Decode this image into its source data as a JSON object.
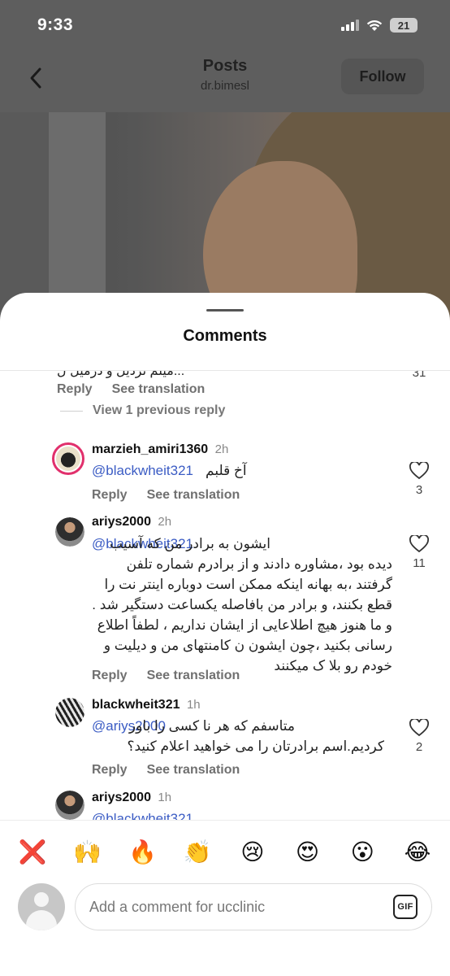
{
  "status": {
    "time": "9:33",
    "battery": "21"
  },
  "header": {
    "title": "Posts",
    "subtitle": "dr.bimesl",
    "follow_label": "Follow"
  },
  "sheet": {
    "title": "Comments"
  },
  "cut_comment": {
    "text": "...ميلم ترديل و درميل ل",
    "actions": {
      "reply": "Reply",
      "translate": "See translation"
    },
    "likes": "31"
  },
  "view_replies": "View 1 previous reply",
  "comments": [
    {
      "user": "marzieh_amiri1360",
      "time": "2h",
      "mention": "@blackwheit321",
      "text": "آخ قلبم",
      "reply": "Reply",
      "translate": "See translation",
      "likes": "3"
    },
    {
      "user": "ariys2000",
      "time": "2h",
      "mention": "@blackwheit321",
      "text": "ایشون به برادر من که آسیب دیده بود ،مشاوره دادند و از برادرم شماره تلفن گرفتند ،به بهانه اینکه ممکن است دوباره اینتر نت را قطع بکنند، و برادر من بافاصله یکساعت دستگیر شد . و ما هنوز هیچ اطلاعایی از ایشان نداریم ، لطفاً اطلاع رسانی بکنید ،چون ایشون ن کامنتهای من و دیلیت و خودم رو بلا ک میکنند",
      "reply": "Reply",
      "translate": "See translation",
      "likes": "11"
    },
    {
      "user": "blackwheit321",
      "time": "1h",
      "mention": "@ariys2000",
      "text": "متاسفم که هر نا کسی را باور کردیم.اسم برادرتان را می خواهید اعلام کنید؟",
      "reply": "Reply",
      "translate": "See translation",
      "likes": "2"
    },
    {
      "user": "ariys2000",
      "time": "1h",
      "mention": "@blackwheit321"
    }
  ],
  "reactions": [
    "❌",
    "🙌",
    "🔥",
    "👏",
    "😢",
    "😍",
    "😮",
    "😂"
  ],
  "input": {
    "placeholder": "Add a comment for ucclinic",
    "gif_label": "GIF"
  },
  "colors": {
    "mention": "#3b5cc4",
    "dim_background": "#5e5e5e",
    "story_ring": "#e1306c"
  }
}
